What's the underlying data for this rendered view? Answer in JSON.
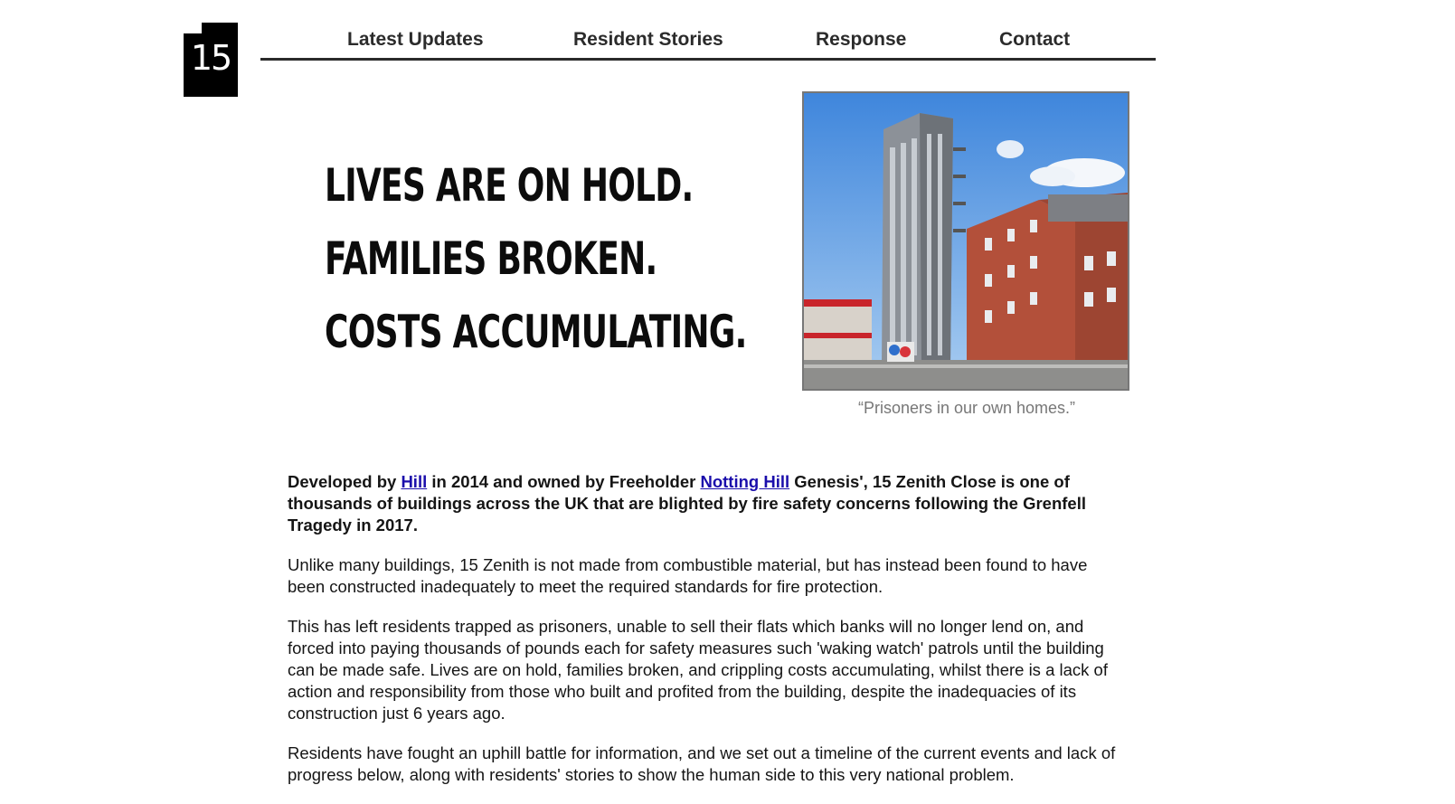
{
  "logo": {
    "text": "15"
  },
  "nav": {
    "items": [
      "Latest Updates",
      "Resident Stories",
      "Response",
      "Contact"
    ]
  },
  "hero": {
    "lines": [
      "Lives are on hold.",
      "Families broken.",
      "Costs accumulating."
    ],
    "photo_caption": "“Prisoners in our own homes.”"
  },
  "article": {
    "lead": {
      "part1": "Developed by ",
      "link1": "Hill",
      "part2": " in 2014 and owned by Freeholder ",
      "link2": "Notting Hill",
      "part3": " Genesis', 15 Zenith Close is one of thousands of buildings across the UK that are blighted by fire safety concerns following the Grenfell Tragedy in 2017."
    },
    "p2": "Unlike many buildings, 15 Zenith is not made from combustible material, but has instead been found to have been constructed inadequately to meet the required standards for fire protection.",
    "p3": "This has left residents trapped as prisoners, unable to sell their flats which banks will no longer lend on, and forced into paying thousands of pounds each for safety measures such 'waking watch' patrols until the building can be made safe. Lives are on hold, families broken, and crippling costs accumulating, whilst there is a lack of action and responsibility from those who built and profited from the building, despite the inadequacies of its construction just 6 years ago.",
    "p4": "Residents have fought an uphill battle for information, and we set out a timeline of the current events and lack of progress below, along with residents' stories to show the human side to this very national problem."
  },
  "colors": {
    "link": "#1a0dab",
    "sky": "#4f95e0",
    "brick": "#b3503a",
    "tower": "#8c9198"
  }
}
